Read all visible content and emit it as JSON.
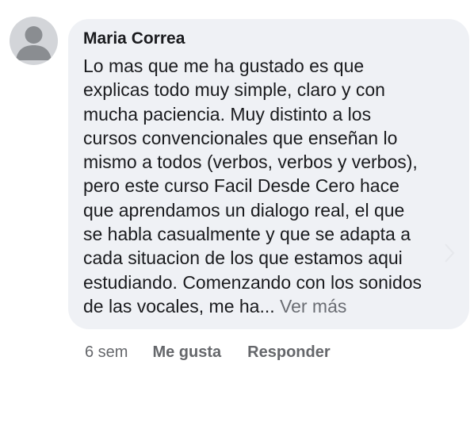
{
  "comment": {
    "author": "Maria Correa",
    "lines": [
      "Lo mas que me ha gustado es que",
      "explicas todo muy simple, claro y con",
      "mucha paciencia. Muy distinto a los",
      "cursos convencionales que enseñan lo",
      "mismo a todos (verbos, verbos y verbos),",
      "pero este curso Facil Desde Cero hace",
      "que aprendamos un dialogo real, el que",
      "se habla casualmente y que se adapta a",
      "cada situacion de los que estamos aqui",
      "estudiando. Comenzando con los sonidos",
      "de las vocales, me ha..."
    ],
    "see_more_label": "Ver más",
    "timestamp": "6 sem",
    "like_label": "Me gusta",
    "reply_label": "Responder"
  },
  "icons": {
    "avatar": "default-profile-silhouette-icon",
    "chevron": "chevron-right-icon"
  },
  "colors": {
    "bubble_bg": "#eff1f5",
    "text": "#1a1b1e",
    "meta_text": "#65676b",
    "avatar_bg": "#d3d5d9",
    "avatar_figure": "#8a8d91"
  }
}
